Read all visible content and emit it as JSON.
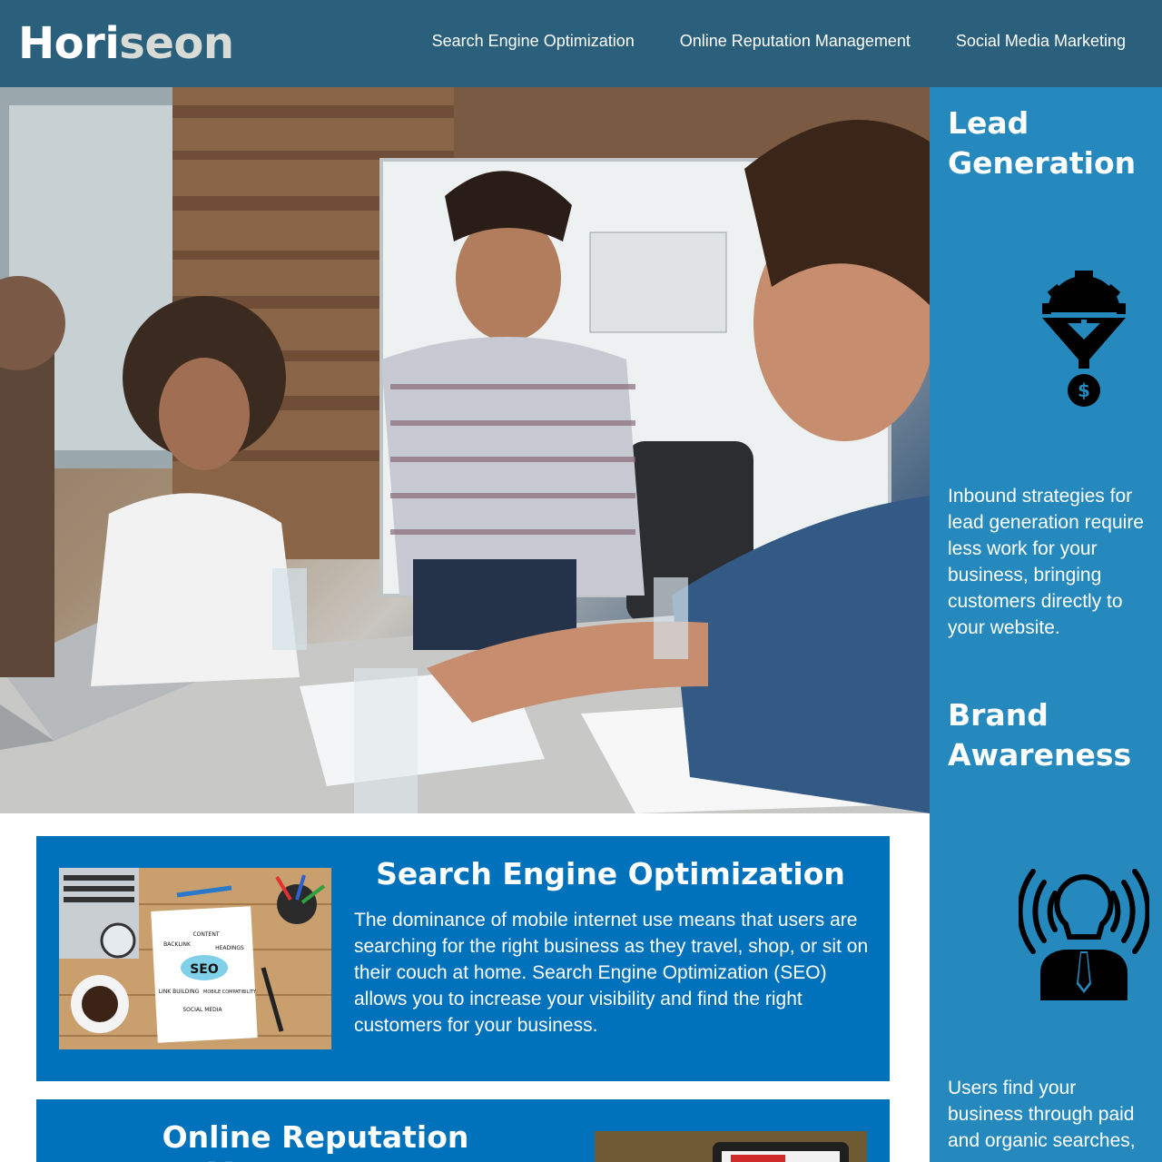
{
  "header": {
    "logo_main": "Hori",
    "logo_accent": "seon",
    "nav": [
      {
        "label": "Search Engine Optimization"
      },
      {
        "label": "Online Reputation Management"
      },
      {
        "label": "Social Media Marketing"
      }
    ]
  },
  "hero": {
    "icon": "team-meeting-photo"
  },
  "cards": {
    "seo": {
      "title": "Search Engine Optimization",
      "text": "The dominance of mobile internet use means that users are searching for the right business as they travel, shop, or sit on their couch at home. Search Engine Optimization (SEO) allows you to increase your visibility and find the right customers for your business.",
      "image_labels": [
        "SEO",
        "CONTENT",
        "BACKLINK",
        "HEADINGS",
        "LINK BUILDING",
        "MOBILE COMPATIBILITY",
        "SOCIAL MEDIA"
      ]
    },
    "orm": {
      "title": "Online Reputation Management"
    }
  },
  "sidebar": {
    "lead": {
      "title": "Lead Generation",
      "icon": "funnel-gear-dollar-icon",
      "text": "Inbound strategies for lead generation require less work for your business, bringing customers directly to your website."
    },
    "brand": {
      "title": "Brand Awareness",
      "icon": "lightbulb-head-broadcast-icon",
      "text": "Users find your business through paid and organic searches,"
    }
  },
  "colors": {
    "header_bg": "#2a607c",
    "card_bg": "#0072bb",
    "sidebar_bg": "#2589bd",
    "logo_accent": "#d9dcd6"
  }
}
